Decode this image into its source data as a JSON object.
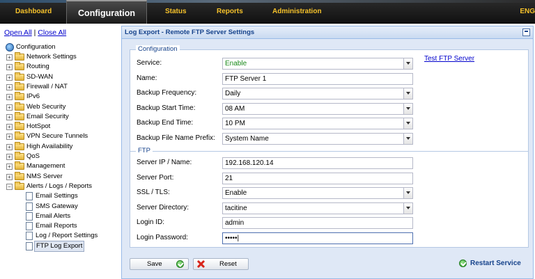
{
  "nav": {
    "items": [
      "Dashboard",
      "Configuration",
      "Status",
      "Reports",
      "Administration"
    ],
    "active": "Configuration",
    "lang": "ENG"
  },
  "sidebar": {
    "open_all": "Open All",
    "separator": "|",
    "close_all": "Close All",
    "root": "Configuration",
    "items": [
      "Network Settings",
      "Routing",
      "SD-WAN",
      "Firewall / NAT",
      "IPv6",
      "Web Security",
      "Email Security",
      "HotSpot",
      "VPN Secure Tunnels",
      "High Availability",
      "QoS",
      "Management",
      "NMS Server",
      "Alerts / Logs / Reports"
    ],
    "sub_items": [
      "Email Settings",
      "SMS Gateway",
      "Email Alerts",
      "Email Reports",
      "Log / Report Settings",
      "FTP Log Export"
    ],
    "selected": "FTP Log Export"
  },
  "panel": {
    "title": "Log Export - Remote FTP Server Settings",
    "configuration": {
      "legend": "Configuration",
      "test_link": "Test FTP Server",
      "fields": [
        {
          "label": "Service:",
          "value": "Enable",
          "type": "combo"
        },
        {
          "label": "Name:",
          "value": "FTP Server 1",
          "type": "text"
        },
        {
          "label": "Backup Frequency:",
          "value": "Daily",
          "type": "combo"
        },
        {
          "label": "Backup Start Time:",
          "value": "08 AM",
          "type": "combo"
        },
        {
          "label": "Backup End Time:",
          "value": "10 PM",
          "type": "combo"
        },
        {
          "label": "Backup File Name Prefix:",
          "value": "System Name",
          "type": "combo"
        }
      ]
    },
    "ftp": {
      "legend": "FTP",
      "fields": [
        {
          "label": "Server IP / Name:",
          "value": "192.168.120.14",
          "type": "text"
        },
        {
          "label": "Server Port:",
          "value": "21",
          "type": "text"
        },
        {
          "label": "SSL / TLS:",
          "value": "Enable",
          "type": "combo"
        },
        {
          "label": "Server Directory:",
          "value": "tacitine",
          "type": "combo"
        },
        {
          "label": "Login ID:",
          "value": "admin",
          "type": "text"
        },
        {
          "label": "Login Password:",
          "value": "•••••|",
          "type": "password"
        }
      ]
    },
    "buttons": {
      "save": "Save",
      "reset": "Reset",
      "restart": "Restart Service"
    }
  },
  "colors": {
    "nav_text": "#f6c22a",
    "panel_title": "#15428b",
    "enable_green": "#1a8a1a",
    "link": "#0000cc"
  }
}
